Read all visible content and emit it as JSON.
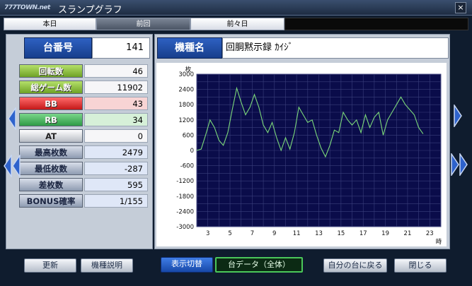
{
  "window": {
    "logo": "777TOWN.net",
    "title": "スランプグラフ",
    "close_label": "×"
  },
  "tabs": [
    {
      "label": "本日"
    },
    {
      "label": "前回"
    },
    {
      "label": "前々日"
    }
  ],
  "machine": {
    "number_label": "台番号",
    "number_value": "141",
    "name_label": "機種名",
    "name_value": "回胴黙示録 ｶｲｼﾞ"
  },
  "stats": [
    {
      "label": "回転数",
      "value": "46"
    },
    {
      "label": "総ゲーム数",
      "value": "11902"
    },
    {
      "label": "BB",
      "value": "43"
    },
    {
      "label": "RB",
      "value": "34"
    },
    {
      "label": "AT",
      "value": "0"
    },
    {
      "label": "最高枚数",
      "value": "2479"
    },
    {
      "label": "最低枚数",
      "value": "-287"
    },
    {
      "label": "差枚数",
      "value": "595"
    },
    {
      "label": "BONUS確率",
      "value": "1/155"
    }
  ],
  "buttons": {
    "update": "更新",
    "machine_info": "機種説明",
    "display_toggle": "表示切替",
    "data_mode": "台データ（全体）",
    "return_self": "自分の台に戻る",
    "close": "閉じる"
  },
  "colors": {
    "accent": "#1f4fae",
    "chart_bg": "#0a0c4a",
    "chart_line": "#7cd87a"
  },
  "chart_data": {
    "type": "line",
    "ylabel": "枚",
    "xlabel": "時",
    "ylim": [
      -3000,
      3000
    ],
    "yticks": [
      3000,
      2400,
      1800,
      1200,
      600,
      0,
      -600,
      -1200,
      -1800,
      -2400,
      -3000
    ],
    "xticks": [
      3,
      5,
      7,
      9,
      11,
      13,
      15,
      17,
      19,
      21,
      23
    ],
    "xlim": [
      2,
      24
    ],
    "grid": true,
    "x": [
      2.0,
      2.4,
      2.8,
      3.2,
      3.6,
      4.0,
      4.4,
      4.8,
      5.2,
      5.6,
      6.0,
      6.4,
      6.8,
      7.2,
      7.6,
      8.0,
      8.4,
      8.8,
      9.2,
      9.6,
      10.0,
      10.4,
      10.8,
      11.2,
      11.6,
      12.0,
      12.4,
      12.8,
      13.2,
      13.6,
      14.0,
      14.4,
      14.8,
      15.2,
      15.6,
      16.0,
      16.4,
      16.8,
      17.2,
      17.6,
      18.0,
      18.4,
      18.8,
      19.2,
      19.6,
      20.0,
      20.4,
      20.8,
      21.2,
      21.6,
      22.0,
      22.4
    ],
    "y": [
      0,
      50,
      600,
      1200,
      900,
      400,
      200,
      700,
      1600,
      2450,
      1900,
      1400,
      1700,
      2200,
      1700,
      1000,
      700,
      1100,
      500,
      0,
      500,
      50,
      700,
      1700,
      1400,
      1100,
      1200,
      600,
      100,
      -250,
      200,
      800,
      700,
      1500,
      1200,
      1000,
      1200,
      700,
      1400,
      900,
      1300,
      1500,
      600,
      1200,
      1500,
      1800,
      2100,
      1800,
      1600,
      1400,
      900,
      650
    ]
  }
}
